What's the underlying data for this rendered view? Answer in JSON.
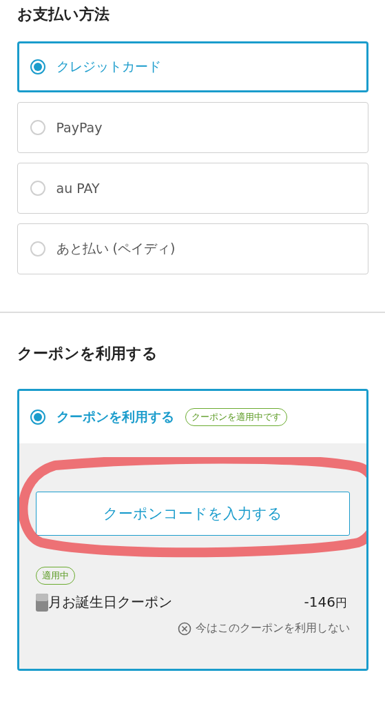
{
  "payment": {
    "title": "お支払い方法",
    "options": [
      {
        "label": "クレジットカード",
        "selected": true
      },
      {
        "label": "PayPay",
        "selected": false
      },
      {
        "label": "au PAY",
        "selected": false
      },
      {
        "label": "あと払い (ペイディ)",
        "selected": false
      }
    ]
  },
  "coupon": {
    "title": "クーポンを利用する",
    "option": {
      "label": "クーポンを利用する",
      "selected": true,
      "badge": "クーポンを適用中です"
    },
    "enter_button": "クーポンコードを入力する",
    "applied": {
      "badge": "適用中",
      "name": "月お誕生日クーポン",
      "amount": "-146",
      "currency": "円",
      "remove": "今はこのクーポンを利用しない"
    }
  }
}
